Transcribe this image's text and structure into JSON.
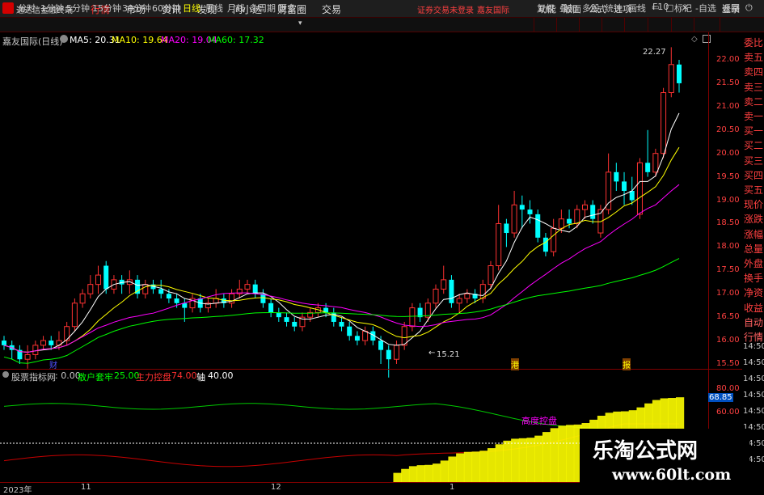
{
  "top_menu": {
    "app_name": "通达信金融终端",
    "items": [
      "行情",
      "市场",
      "资讯",
      "发现",
      "问小达",
      "财富圈",
      "交易"
    ],
    "notice": "证券交易未登录",
    "current_stock": "嘉友国际",
    "right_items": [
      "功能",
      "版面",
      "公式",
      "选项"
    ],
    "login": "登录"
  },
  "period_bar": {
    "periods": [
      "分时",
      "1分钟",
      "5分钟",
      "15分钟",
      "30分钟",
      "60分钟",
      "日线",
      "周线",
      "月线",
      "多周期",
      "更多"
    ],
    "active": "日线",
    "tools": [
      "复权",
      "叠加",
      "多股",
      "统计",
      "画线",
      "F10",
      "标记",
      "-自选",
      "返回"
    ]
  },
  "main_chart": {
    "title": "嘉友国际(日线)",
    "ma5": "MA5: 20.31",
    "ma10": "MA10: 19.64",
    "ma20": "MA20: 19.04",
    "ma60": "MA60: 17.32",
    "high_label": "22.27",
    "low_label": "15.21",
    "marker_cai": "财",
    "marker_gang": "港",
    "marker_bao": "报",
    "y_ticks": [
      "22.00",
      "21.50",
      "21.00",
      "20.50",
      "20.00",
      "19.50",
      "19.00",
      "18.50",
      "18.00",
      "17.50",
      "17.00",
      "16.50",
      "16.00",
      "15.50"
    ],
    "colors": {
      "up": "#ff3232",
      "down": "#00ffff",
      "ma5": "#ffffff",
      "ma10": "#ffff00",
      "ma20": "#ff00ff",
      "ma60": "#00ff00"
    }
  },
  "indicator": {
    "title": "股票指标网",
    "value0": ": 0.00",
    "retail_label": "散户套牢",
    "retail_value": "25.00",
    "main_label": "主力控盘",
    "main_value": "74.00",
    "axis_label": "轴",
    "axis_value": "40.00",
    "tag": "高度控盘",
    "current_value": "68.85",
    "y_ticks": [
      "80.00",
      "60.00"
    ]
  },
  "dates": [
    "2023年",
    "11",
    "12",
    "1"
  ],
  "right_panel": {
    "labels": [
      "委比",
      "卖五",
      "卖四",
      "卖三",
      "卖二",
      "卖一",
      "买一",
      "买二",
      "买三",
      "买四",
      "买五",
      "现价",
      "涨跌",
      "涨幅",
      "总量",
      "外盘",
      "换手",
      "净资",
      "收益",
      "自动",
      "行情"
    ],
    "times": [
      "14:50",
      "14:50",
      "14:50",
      "14:50",
      "14:50",
      "14:50",
      "14:50",
      "14:50"
    ]
  },
  "watermark": {
    "line1": "乐淘公式网",
    "line2": "www.60lt.com"
  }
}
